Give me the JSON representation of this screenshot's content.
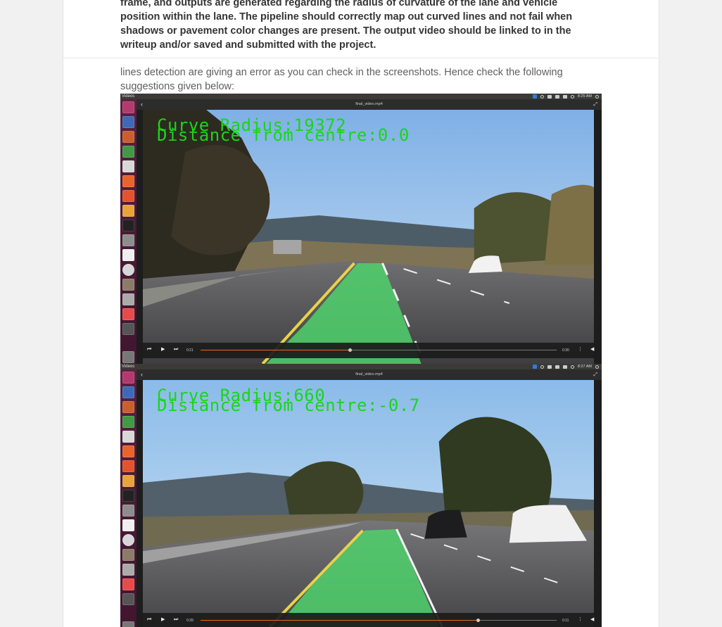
{
  "spec_text": "frame, and outputs are generated regarding the radius of curvature of the lane and vehicle position within the lane. The pipeline should correctly map out curved lines and not fail when shadows or pavement color changes are present. The output video should be linked to in the writeup and/or saved and submitted with the project.",
  "review_text": "lines detection are giving an error as you can check in the screenshots. Hence check the following suggestions given below:",
  "screenshots": [
    {
      "app_title": "Videos",
      "clock": "8:25 AM",
      "file_name": "final_video.mp4",
      "overlay_line1": "Curve Radius:19372",
      "overlay_line2": "Distance from centre:0.0",
      "elapsed": "0:21",
      "remaining": "0:30",
      "progress": 0.42
    },
    {
      "app_title": "Videos",
      "clock": "8:27 AM",
      "file_name": "final_video.mp4",
      "overlay_line1": "Curve Radius:660",
      "overlay_line2": "Distance from centre:-0.7",
      "elapsed": "0:39",
      "remaining": "0:11",
      "progress": 0.78
    }
  ],
  "colors": {
    "lane_fill": "#4fd16b",
    "overlay_text": "#19d619",
    "launcher": "#4a1a36",
    "progress": "#e86a1a"
  },
  "icons": [
    "back-arrow-icon",
    "fullscreen-icon",
    "skip-back-icon",
    "play-icon",
    "skip-forward-icon",
    "menu-icon",
    "volume-icon"
  ]
}
